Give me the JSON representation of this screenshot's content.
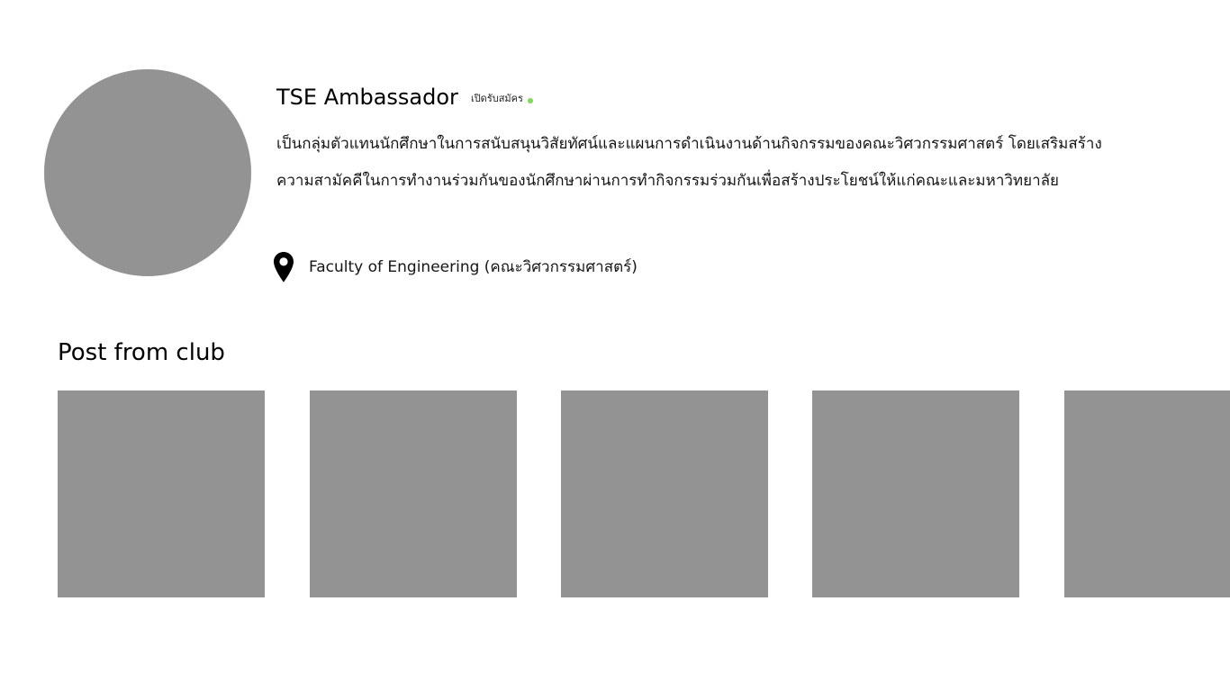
{
  "club": {
    "name": "TSE Ambassador",
    "status": "เปิดรับสมัคร",
    "description": " เป็นกลุ่มตัวแทนนักศึกษาในการสนับสนุนวิสัยทัศน์และแผนการดำเนินงานด้านกิจกรรมของคณะวิศวกรรมศาสตร์ โดยเสริมสร้างความสามัคคีในการทำงานร่วมกันของนักศึกษาผ่านการทำกิจกรรมร่วมกันเพื่อสร้างประโยชน์ให้แก่คณะและมหาวิทยาลัย",
    "location": "Faculty of Engineering (คณะวิศวกรรมศาสตร์)"
  },
  "posts": {
    "section_title": "Post from club",
    "items": [
      {
        "name": "post-1"
      },
      {
        "name": "post-2"
      },
      {
        "name": "post-3"
      },
      {
        "name": "post-4"
      },
      {
        "name": "post-5"
      }
    ]
  },
  "icons": {
    "location": "map-pin-icon"
  },
  "colors": {
    "placeholder": "#939393",
    "status_dot": "#7ed957",
    "text": "#111111"
  }
}
